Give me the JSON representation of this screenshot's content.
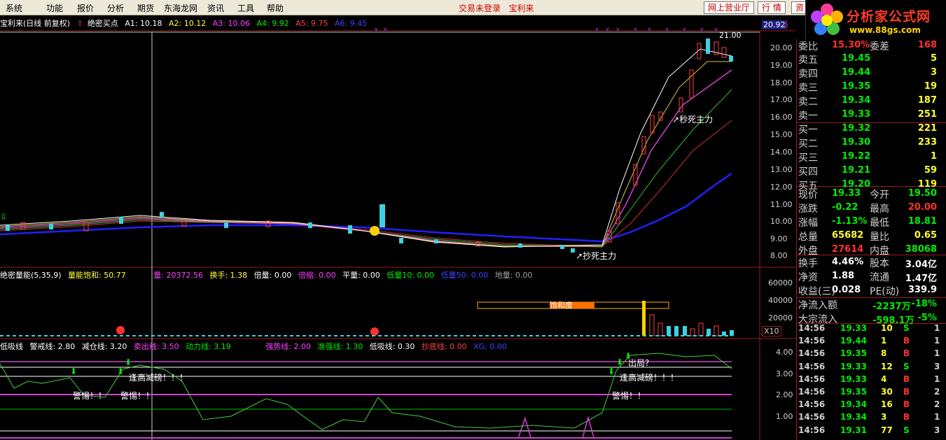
{
  "menu": {
    "items": [
      "系统",
      "功能",
      "报价",
      "分析",
      "期货",
      "东海龙网",
      "资讯",
      "工具",
      "帮助"
    ],
    "status_left": "交易未登录",
    "status_right": "宝利来",
    "buttons": [
      "网上营业厅",
      "行 情",
      "资"
    ]
  },
  "logo": {
    "text": "分析家公式网",
    "url": "www.88gs.com"
  },
  "price_chart": {
    "title": "宝利来(日线 前复权)",
    "indicator": "绝密买点",
    "params": [
      {
        "label": "A1: 10.18",
        "color": "#ffffff"
      },
      {
        "label": "A2: 10.12",
        "color": "#ffff40"
      },
      {
        "label": "A3: 10.06",
        "color": "#ff40ff"
      },
      {
        "label": "A4: 9.92",
        "color": "#00ee00"
      },
      {
        "label": "A5: 9.75",
        "color": "#ff4040"
      },
      {
        "label": "A6: 9.45",
        "color": "#4040ff"
      }
    ],
    "max_label": "21.00",
    "top_axis_value": "20.92",
    "annotation_top": "秒死主力",
    "annotation_bottom": "抄死主力",
    "axis": [
      "20.00",
      "19.00",
      "18.00",
      "17.00",
      "16.00",
      "15.00",
      "14.00",
      "13.00",
      "12.00",
      "11.00",
      "10.00",
      "9.00",
      "8.00"
    ]
  },
  "volume_chart": {
    "title": "绝密量能(5,35,9)",
    "params": [
      {
        "label": "量能饱和: 50.77",
        "color": "#ffff40"
      },
      {
        "label": "量: 20372.56",
        "color": "#ff40ff"
      },
      {
        "label": "换手: 1.38",
        "color": "#ffff40"
      },
      {
        "label": "倍量: 0.00",
        "color": "#ffffff"
      },
      {
        "label": "倍缩: 0.00",
        "color": "#ff40ff"
      },
      {
        "label": "平量: 0.00",
        "color": "#ffffff"
      },
      {
        "label": "低量10: 0.00",
        "color": "#00ee00"
      },
      {
        "label": "低量50: 0.00",
        "color": "#4040ff"
      },
      {
        "label": "地量: 0.00",
        "color": "#a0a0a0"
      }
    ],
    "saturation_label": "饱和度",
    "axis": [
      "60000",
      "40000",
      "20000"
    ],
    "unit": "X10"
  },
  "lower_chart": {
    "title": "低吸线",
    "params": [
      {
        "label": "警戒线: 2.80",
        "color": "#ffffff"
      },
      {
        "label": "减仓线: 3.20",
        "color": "#ffffff"
      },
      {
        "label": "卖出线: 3.50",
        "color": "#ff40ff"
      },
      {
        "label": "动力线: 3.19",
        "color": "#00ee00"
      },
      {
        "label": "强势线: 2.00",
        "color": "#ff40ff"
      },
      {
        "label": "准强线: 1.30",
        "color": "#00ee00"
      },
      {
        "label": "低吸线: 0.30",
        "color": "#ffffff"
      },
      {
        "label": "抄底线: 0.00",
        "color": "#ff4040"
      },
      {
        "label": "XG: 0.00",
        "color": "#4040ff"
      }
    ],
    "warn_label": "警惕！！",
    "alert_label": "逢高减磅！！！",
    "exit_label": "出局?",
    "axis": [
      "4.00",
      "3.00",
      "2.00",
      "1.00"
    ]
  },
  "quote_panel": {
    "rows": [
      {
        "label": "委比",
        "value": "15.30%",
        "color": "#ff3030",
        "label2": "委差",
        "value2": "168",
        "color2": "#ff3030"
      },
      {
        "label": "卖五",
        "value": "19.45",
        "color": "#00ee00",
        "value2": "5",
        "color2": "#ffff30"
      },
      {
        "label": "卖四",
        "value": "19.44",
        "color": "#00ee00",
        "value2": "3",
        "color2": "#ffff30"
      },
      {
        "label": "卖三",
        "value": "19.35",
        "color": "#00ee00",
        "value2": "19",
        "color2": "#ffff30"
      },
      {
        "label": "卖二",
        "value": "19.34",
        "color": "#00ee00",
        "value2": "187",
        "color2": "#ffff30"
      },
      {
        "label": "卖一",
        "value": "19.33",
        "color": "#00ee00",
        "value2": "251",
        "color2": "#ffff30"
      },
      {
        "label": "买一",
        "value": "19.32",
        "color": "#00ee00",
        "value2": "221",
        "color2": "#ffff30"
      },
      {
        "label": "买二",
        "value": "19.30",
        "color": "#00ee00",
        "value2": "233",
        "color2": "#ffff30"
      },
      {
        "label": "买三",
        "value": "19.22",
        "color": "#00ee00",
        "value2": "1",
        "color2": "#ffff30"
      },
      {
        "label": "买四",
        "value": "19.21",
        "color": "#00ee00",
        "value2": "59",
        "color2": "#ffff30"
      },
      {
        "label": "买五",
        "value": "19.20",
        "color": "#00ee00",
        "value2": "119",
        "color2": "#ffff30"
      },
      {
        "label": "现价",
        "value": "19.33",
        "color": "#00ee00",
        "label2": "今开",
        "value2": "19.50",
        "color2": "#00ee00"
      },
      {
        "label": "涨跌",
        "value": "-0.22",
        "color": "#00ee00",
        "label2": "最高",
        "value2": "20.00",
        "color2": "#ff3030"
      },
      {
        "label": "涨幅",
        "value": "-1.13%",
        "color": "#00ee00",
        "label2": "最低",
        "value2": "18.81",
        "color2": "#00ee00"
      },
      {
        "label": "总量",
        "value": "65682",
        "color": "#ffff30",
        "label2": "量比",
        "value2": "0.65",
        "color2": "#ffff30"
      },
      {
        "label": "外盘",
        "value": "27614",
        "color": "#ff3030",
        "label2": "内盘",
        "value2": "38068",
        "color2": "#00ee00"
      },
      {
        "label": "换手",
        "value": "4.46%",
        "color": "#ffffff",
        "label2": "股本",
        "value2": "3.04亿",
        "color2": "#ffffff"
      },
      {
        "label": "净资",
        "value": "1.88",
        "color": "#ffffff",
        "label2": "流通",
        "value2": "1.47亿",
        "color2": "#ffffff"
      },
      {
        "label": "收益(三)",
        "value": "0.028",
        "color": "#ffffff",
        "label2": "PE(动)",
        "value2": "339.9",
        "color2": "#ffffff"
      },
      {
        "label": "净流入额",
        "value": "-2237万",
        "color": "#00ee00",
        "value2": "-18%",
        "color2": "#00ee00"
      },
      {
        "label": "大宗流入",
        "value": "-598.1万",
        "color": "#00ee00",
        "value2": "-5%",
        "color2": "#00ee00"
      }
    ],
    "ticks": [
      {
        "time": "14:56",
        "price": "19.33",
        "vol": "10",
        "side": "S",
        "n": "1"
      },
      {
        "time": "14:56",
        "price": "19.44",
        "vol": "1",
        "side": "B",
        "n": "1"
      },
      {
        "time": "14:56",
        "price": "19.35",
        "vol": "8",
        "side": "B",
        "n": "1"
      },
      {
        "time": "14:56",
        "price": "19.33",
        "vol": "12",
        "side": "S",
        "n": "3"
      },
      {
        "time": "14:56",
        "price": "19.33",
        "vol": "4",
        "side": "B",
        "n": "1"
      },
      {
        "time": "14:56",
        "price": "19.35",
        "vol": "30",
        "side": "B",
        "n": "2"
      },
      {
        "time": "14:56",
        "price": "19.34",
        "vol": "16",
        "side": "B",
        "n": "2"
      },
      {
        "time": "14:56",
        "price": "19.34",
        "vol": "3",
        "side": "B",
        "n": "1"
      },
      {
        "time": "14:56",
        "price": "19.31",
        "vol": "77",
        "side": "S",
        "n": "3"
      }
    ]
  }
}
